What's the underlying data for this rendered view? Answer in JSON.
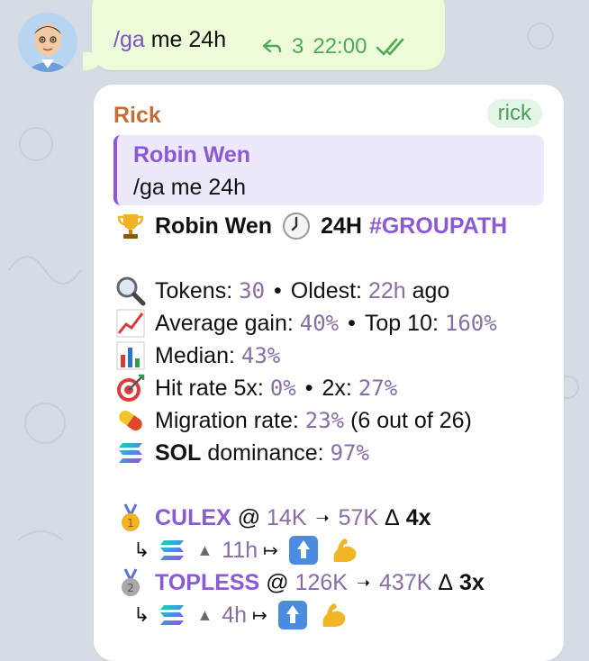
{
  "outgoing": {
    "command": "/ga",
    "text": "me 24h",
    "reply_count": "3",
    "time": "22:00"
  },
  "incoming": {
    "sender": "Rick",
    "sender_tag": "rick",
    "quote": {
      "name": "Robin Wen",
      "text": "/ga me 24h"
    },
    "header": {
      "name": "Robin Wen",
      "period": "24H",
      "hashtag": "#GROUPATH"
    },
    "stats": {
      "tokens_label": "Tokens:",
      "tokens": "30",
      "oldest_label": "Oldest:",
      "oldest": "22h",
      "oldest_suffix": "ago",
      "avg_gain_label": "Average gain:",
      "avg_gain": "40%",
      "top10_label": "Top 10:",
      "top10": "160%",
      "median_label": "Median:",
      "median": "43%",
      "hit5_label": "Hit rate 5x:",
      "hit5": "0%",
      "hit2_label": "2x:",
      "hit2": "27%",
      "migration_label": "Migration rate:",
      "migration": "23%",
      "migration_detail": "(6 out of 26)",
      "dominance_chain": "SOL",
      "dominance_label": "dominance:",
      "dominance": "97%"
    },
    "picks": [
      {
        "name": "CULEX",
        "at": "@",
        "entry": "14K",
        "peak": "57K",
        "delta": "Δ",
        "mult": "4x",
        "age": "11h"
      },
      {
        "name": "TOPLESS",
        "at": "@",
        "entry": "126K",
        "peak": "437K",
        "delta": "Δ",
        "mult": "3x",
        "age": "4h"
      }
    ],
    "glyphs": {
      "dot": "•",
      "arrow": "➝",
      "hook": "↳",
      "up": "▲",
      "mapsto": "↦"
    }
  },
  "icons": [
    "reply-icon",
    "double-check-icon",
    "trophy-icon",
    "clock-icon",
    "magnifier-icon",
    "chart-up-icon",
    "bar-chart-icon",
    "target-icon",
    "pill-icon",
    "solana-icon",
    "gold-medal-icon",
    "silver-medal-icon",
    "up-button-icon",
    "flexed-biceps-icon"
  ],
  "colors": {
    "outgoing_bubble": "#eefbd9",
    "accent_purple": "#8a5ad6",
    "sender_orange": "#c86c33",
    "value_mauve": "#8a6ca6"
  }
}
